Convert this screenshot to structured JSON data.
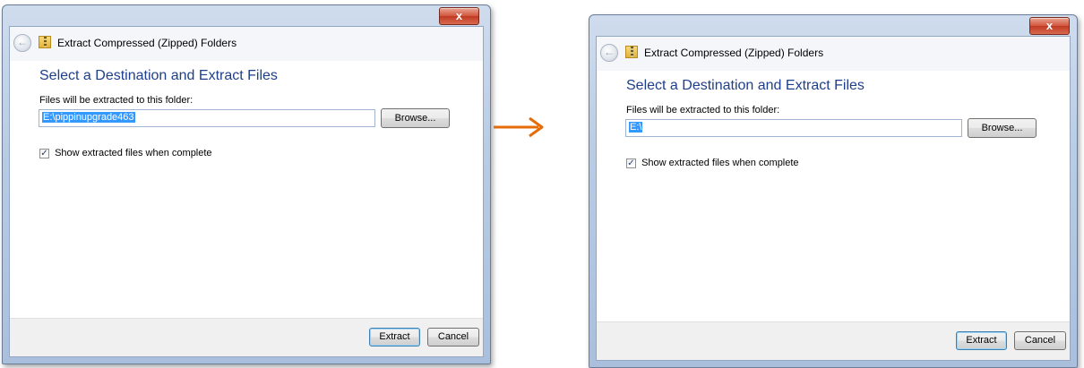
{
  "dialogs": [
    {
      "close_label": "x",
      "back_label": "←",
      "window_title": "Extract Compressed (Zipped) Folders",
      "main_instruction": "Select a Destination and Extract Files",
      "folder_label": "Files will be extracted to this folder:",
      "path_value": "E:\\pippinupgrade463",
      "browse_label": "Browse...",
      "checkbox_checked": true,
      "checkbox_mark": "✓",
      "checkbox_label": "Show extracted files when complete",
      "extract_label": "Extract",
      "cancel_label": "Cancel"
    },
    {
      "close_label": "x",
      "back_label": "←",
      "window_title": "Extract Compressed (Zipped) Folders",
      "main_instruction": "Select a Destination and Extract Files",
      "folder_label": "Files will be extracted to this folder:",
      "path_value": "E:\\",
      "browse_label": "Browse...",
      "checkbox_checked": true,
      "checkbox_mark": "✓",
      "checkbox_label": "Show extracted files when complete",
      "extract_label": "Extract",
      "cancel_label": "Cancel"
    }
  ],
  "arrow_color": "#e46c0a"
}
